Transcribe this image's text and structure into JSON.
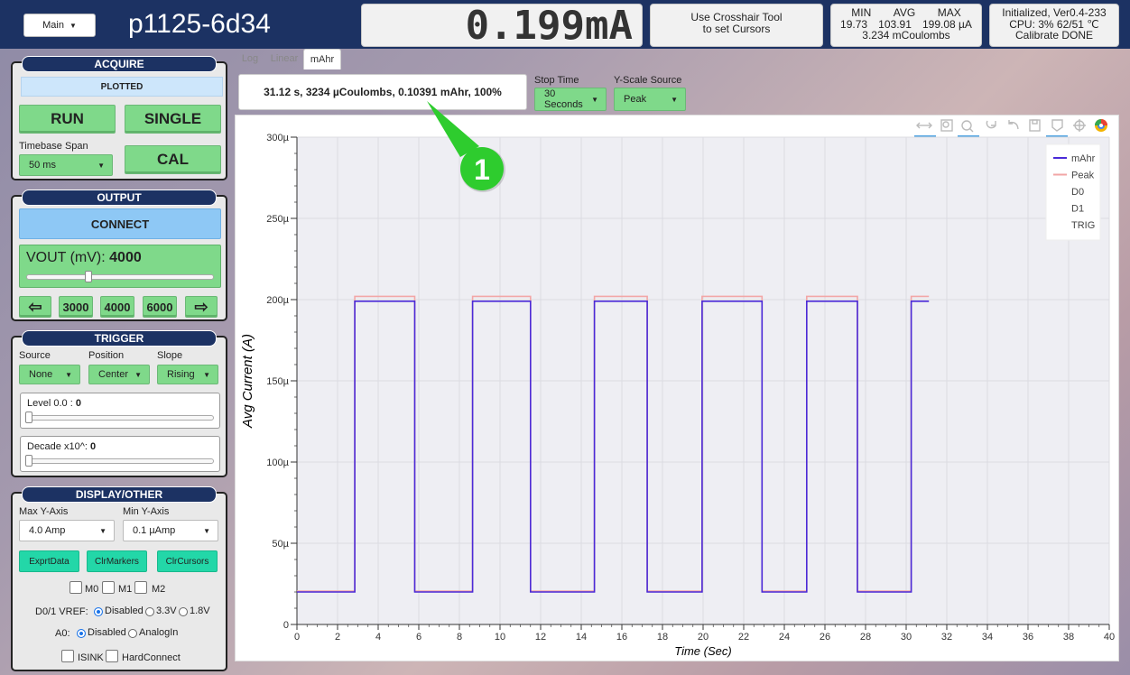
{
  "header": {
    "main_menu": "Main",
    "device_id": "p1125-6d34",
    "readout": "0.199mA",
    "cursor_hint_1": "Use Crosshair Tool",
    "cursor_hint_2": "to set Cursors",
    "stats": {
      "min_label": "MIN",
      "avg_label": "AVG",
      "max_label": "MAX",
      "min": "19.73",
      "avg": "103.91",
      "max": "199.08 µA",
      "coulombs": "3.234 mCoulombs"
    },
    "status": {
      "line1": "Initialized, Ver0.4-233",
      "line2": "CPU:  3% 62/51 ℃",
      "line3": "Calibrate DONE"
    }
  },
  "acquire": {
    "title": "ACQUIRE",
    "status": "PLOTTED",
    "run": "RUN",
    "single": "SINGLE",
    "cal": "CAL",
    "timebase_label": "Timebase Span",
    "timebase_value": "50 ms"
  },
  "output": {
    "title": "OUTPUT",
    "connect": "CONNECT",
    "vout_label": "VOUT (mV):",
    "vout_value": "4000",
    "left_arrow": "⇦",
    "preset1": "3000",
    "preset2": "4000",
    "preset3": "6000",
    "right_arrow": "⇨",
    "vout_fraction": 0.33
  },
  "trigger": {
    "title": "TRIGGER",
    "source_label": "Source",
    "source_value": "None",
    "position_label": "Position",
    "position_value": "Center",
    "slope_label": "Slope",
    "slope_value": "Rising",
    "level_label": "Level 0.0 : ",
    "level_value": "0",
    "decade_label": "Decade x10^: ",
    "decade_value": "0"
  },
  "display": {
    "title": "DISPLAY/OTHER",
    "max_y_label": "Max Y-Axis",
    "max_y_value": "4.0 Amp",
    "min_y_label": "Min Y-Axis",
    "min_y_value": "0.1 µAmp",
    "export": "ExprtData",
    "clr_markers": "ClrMarkers",
    "clr_cursors": "ClrCursors",
    "m0": "M0",
    "m1": "M1",
    "m2": "M2",
    "vref_label": "D0/1 VREF:",
    "vref_opt1": "Disabled",
    "vref_opt2": "3.3V",
    "vref_opt3": "1.8V",
    "a0_label": "A0:",
    "a0_opt1": "Disabled",
    "a0_opt2": "AnalogIn",
    "isink": "ISINK",
    "hardconnect": "HardConnect"
  },
  "tabs": {
    "log": "Log",
    "linear": "Linear",
    "mahr": "mAhr"
  },
  "controls": {
    "summary": "31.12 s, 3234 µCoulombs, 0.10391 mAhr, 100%",
    "stop_time_label": "Stop Time",
    "stop_time_value": "30 Seconds",
    "yscale_label": "Y-Scale Source",
    "yscale_value": "Peak"
  },
  "callout": {
    "number": "1"
  },
  "colors": {
    "header": "#1c3263",
    "button_green": "#7fd98a",
    "connect_blue": "#8ec8f5",
    "teal": "#23d7a8",
    "mahr_line": "#4a2ad8",
    "peak_line": "#f2a6a6",
    "callout": "#2ecc2e"
  },
  "chart_data": {
    "type": "line",
    "xlabel": "Time (Sec)",
    "ylabel": "Avg Current (A)",
    "xlim": [
      0,
      40
    ],
    "ylim": [
      0,
      0.0003
    ],
    "x_ticks": [
      0,
      2,
      4,
      6,
      8,
      10,
      12,
      14,
      16,
      18,
      20,
      22,
      24,
      26,
      28,
      30,
      32,
      34,
      36,
      38,
      40
    ],
    "y_ticks": [
      {
        "v": 0,
        "label": "0"
      },
      {
        "v": 5e-05,
        "label": "50µ"
      },
      {
        "v": 0.0001,
        "label": "100µ"
      },
      {
        "v": 0.00015,
        "label": "150µ"
      },
      {
        "v": 0.0002,
        "label": "200µ"
      },
      {
        "v": 0.00025,
        "label": "250µ"
      },
      {
        "v": 0.0003,
        "label": "300µ"
      }
    ],
    "grid": true,
    "legend_position": "top-right",
    "legend": [
      "mAhr",
      "Peak",
      "D0",
      "D1",
      "TRIG"
    ],
    "series": [
      {
        "name": "mAhr",
        "color": "#4a2ad8",
        "x": [
          0,
          2.85,
          2.85,
          5.8,
          5.8,
          8.65,
          8.65,
          11.5,
          11.5,
          14.65,
          14.65,
          17.25,
          17.25,
          19.95,
          19.95,
          22.9,
          22.9,
          25.1,
          25.1,
          27.6,
          27.6,
          30.25,
          30.25,
          31.12
        ],
        "y": [
          2e-05,
          2e-05,
          0.000199,
          0.000199,
          2e-05,
          2e-05,
          0.000199,
          0.000199,
          2e-05,
          2e-05,
          0.000199,
          0.000199,
          2e-05,
          2e-05,
          0.000199,
          0.000199,
          2e-05,
          2e-05,
          0.000199,
          0.000199,
          2e-05,
          2e-05,
          0.000199,
          0.000199
        ]
      },
      {
        "name": "Peak",
        "color": "#f2a6a6",
        "x": [
          0,
          2.85,
          2.85,
          5.8,
          5.8,
          8.65,
          8.65,
          11.5,
          11.5,
          14.65,
          14.65,
          17.25,
          17.25,
          19.95,
          19.95,
          22.9,
          22.9,
          25.1,
          25.1,
          27.6,
          27.6,
          30.25,
          30.25,
          31.12
        ],
        "y": [
          2.05e-05,
          2.05e-05,
          0.000202,
          0.000202,
          2.05e-05,
          2.05e-05,
          0.000202,
          0.000202,
          2.05e-05,
          2.05e-05,
          0.000202,
          0.000202,
          2.05e-05,
          2.05e-05,
          0.000202,
          0.000202,
          2.05e-05,
          2.05e-05,
          0.000202,
          0.000202,
          2.05e-05,
          2.05e-05,
          0.000202,
          0.000202
        ]
      }
    ]
  }
}
